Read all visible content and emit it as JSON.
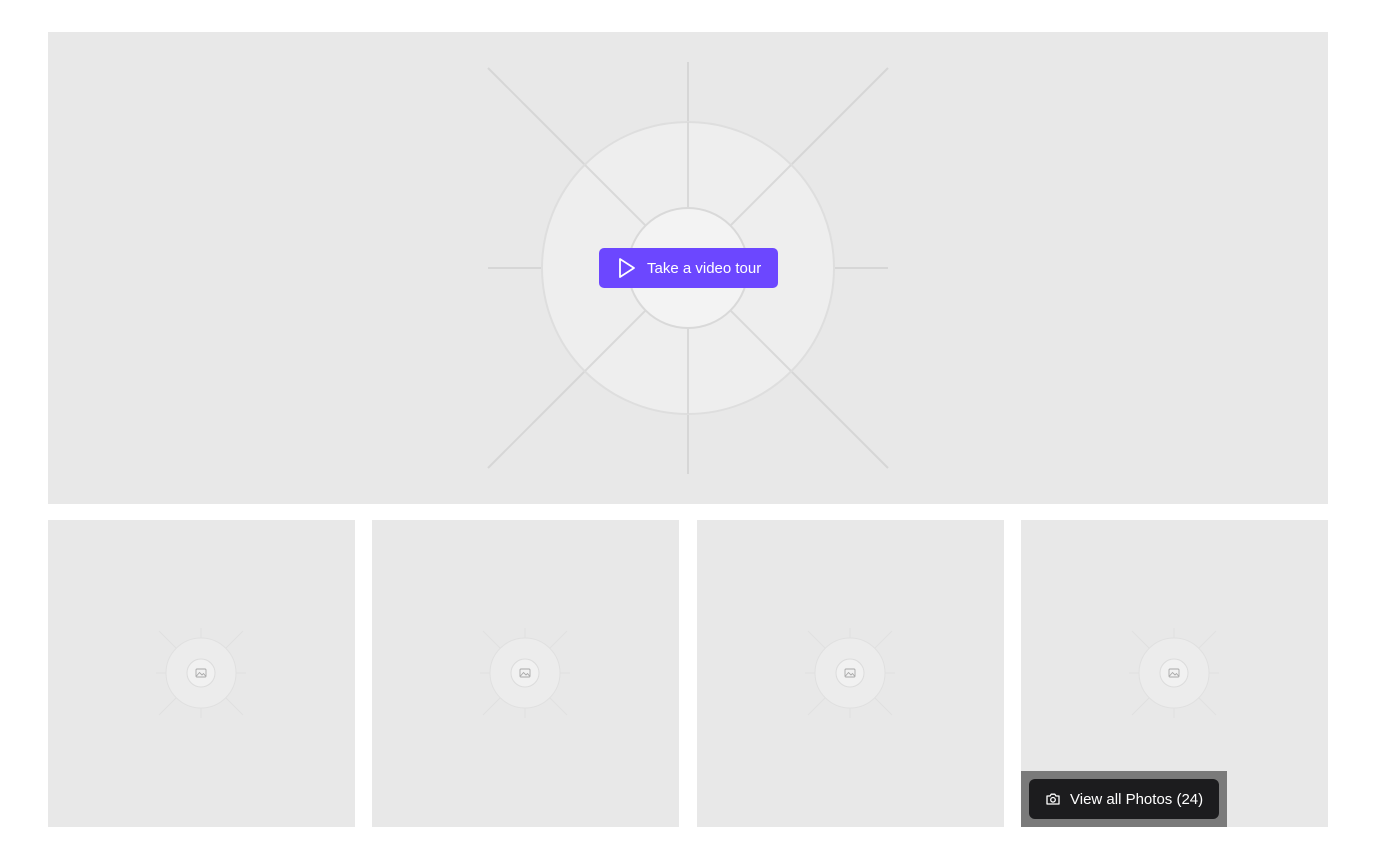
{
  "hero": {
    "video_button_label": "Take a video tour",
    "play_icon": "play-icon",
    "accent_color": "#6c47ff"
  },
  "gallery": {
    "thumbnails": [
      {
        "icon": "image-icon"
      },
      {
        "icon": "image-icon"
      },
      {
        "icon": "image-icon"
      },
      {
        "icon": "image-icon"
      }
    ],
    "view_all_label": "View all Photos (24)",
    "view_all_icon": "camera-icon"
  }
}
